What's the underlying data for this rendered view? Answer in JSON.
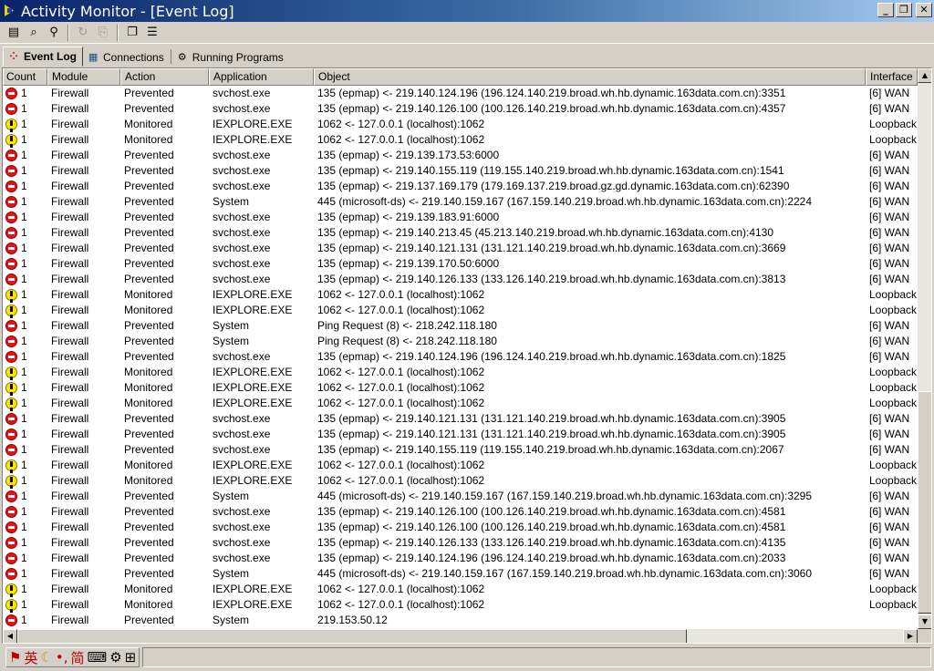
{
  "window": {
    "title": "Activity Monitor - [Event Log]",
    "minimize": "_",
    "restore": "❐",
    "close": "✕"
  },
  "toolbar": [
    {
      "name": "properties-icon",
      "glyph": "▤",
      "enabled": true
    },
    {
      "name": "find-icon",
      "glyph": "⌕",
      "enabled": true
    },
    {
      "name": "network-icon",
      "glyph": "⚲",
      "enabled": true
    },
    {
      "name": "refresh-icon",
      "glyph": "↻",
      "enabled": false
    },
    {
      "name": "export-icon",
      "glyph": "⎘",
      "enabled": false
    },
    {
      "name": "cascade-icon",
      "glyph": "❐",
      "enabled": true
    },
    {
      "name": "tile-icon",
      "glyph": "☰",
      "enabled": true
    }
  ],
  "tabs": [
    {
      "label": "Event Log",
      "icon": "⁘",
      "active": true
    },
    {
      "label": "Connections",
      "icon": "▦",
      "active": false
    },
    {
      "label": "Running Programs",
      "icon": "⚙",
      "active": false
    }
  ],
  "columns": {
    "count": "Count",
    "module": "Module",
    "action": "Action",
    "application": "Application",
    "object": "Object",
    "interface": "Interface"
  },
  "rows": [
    {
      "icon": "stop",
      "count": "1",
      "module": "Firewall",
      "action": "Prevented",
      "app": "svchost.exe",
      "object": "135 (epmap) <- 219.140.124.196 (196.124.140.219.broad.wh.hb.dynamic.163data.com.cn):3351",
      "iface": "[6] WAN"
    },
    {
      "icon": "stop",
      "count": "1",
      "module": "Firewall",
      "action": "Prevented",
      "app": "svchost.exe",
      "object": "135 (epmap) <- 219.140.126.100 (100.126.140.219.broad.wh.hb.dynamic.163data.com.cn):4357",
      "iface": "[6] WAN"
    },
    {
      "icon": "warn",
      "count": "1",
      "module": "Firewall",
      "action": "Monitored",
      "app": "IEXPLORE.EXE",
      "object": "1062 <- 127.0.0.1 (localhost):1062",
      "iface": "Loopback"
    },
    {
      "icon": "warn",
      "count": "1",
      "module": "Firewall",
      "action": "Monitored",
      "app": "IEXPLORE.EXE",
      "object": "1062 <- 127.0.0.1 (localhost):1062",
      "iface": "Loopback"
    },
    {
      "icon": "stop",
      "count": "1",
      "module": "Firewall",
      "action": "Prevented",
      "app": "svchost.exe",
      "object": "135 (epmap) <- 219.139.173.53:6000",
      "iface": "[6] WAN"
    },
    {
      "icon": "stop",
      "count": "1",
      "module": "Firewall",
      "action": "Prevented",
      "app": "svchost.exe",
      "object": "135 (epmap) <- 219.140.155.119 (119.155.140.219.broad.wh.hb.dynamic.163data.com.cn):1541",
      "iface": "[6] WAN"
    },
    {
      "icon": "stop",
      "count": "1",
      "module": "Firewall",
      "action": "Prevented",
      "app": "svchost.exe",
      "object": "135 (epmap) <- 219.137.169.179 (179.169.137.219.broad.gz.gd.dynamic.163data.com.cn):62390",
      "iface": "[6] WAN"
    },
    {
      "icon": "stop",
      "count": "1",
      "module": "Firewall",
      "action": "Prevented",
      "app": "System",
      "object": "445 (microsoft-ds) <- 219.140.159.167 (167.159.140.219.broad.wh.hb.dynamic.163data.com.cn):2224",
      "iface": "[6] WAN"
    },
    {
      "icon": "stop",
      "count": "1",
      "module": "Firewall",
      "action": "Prevented",
      "app": "svchost.exe",
      "object": "135 (epmap) <- 219.139.183.91:6000",
      "iface": "[6] WAN"
    },
    {
      "icon": "stop",
      "count": "1",
      "module": "Firewall",
      "action": "Prevented",
      "app": "svchost.exe",
      "object": "135 (epmap) <- 219.140.213.45 (45.213.140.219.broad.wh.hb.dynamic.163data.com.cn):4130",
      "iface": "[6] WAN"
    },
    {
      "icon": "stop",
      "count": "1",
      "module": "Firewall",
      "action": "Prevented",
      "app": "svchost.exe",
      "object": "135 (epmap) <- 219.140.121.131 (131.121.140.219.broad.wh.hb.dynamic.163data.com.cn):3669",
      "iface": "[6] WAN"
    },
    {
      "icon": "stop",
      "count": "1",
      "module": "Firewall",
      "action": "Prevented",
      "app": "svchost.exe",
      "object": "135 (epmap) <- 219.139.170.50:6000",
      "iface": "[6] WAN"
    },
    {
      "icon": "stop",
      "count": "1",
      "module": "Firewall",
      "action": "Prevented",
      "app": "svchost.exe",
      "object": "135 (epmap) <- 219.140.126.133 (133.126.140.219.broad.wh.hb.dynamic.163data.com.cn):3813",
      "iface": "[6] WAN"
    },
    {
      "icon": "warn",
      "count": "1",
      "module": "Firewall",
      "action": "Monitored",
      "app": "IEXPLORE.EXE",
      "object": "1062 <- 127.0.0.1 (localhost):1062",
      "iface": "Loopback"
    },
    {
      "icon": "warn",
      "count": "1",
      "module": "Firewall",
      "action": "Monitored",
      "app": "IEXPLORE.EXE",
      "object": "1062 <- 127.0.0.1 (localhost):1062",
      "iface": "Loopback"
    },
    {
      "icon": "stop",
      "count": "1",
      "module": "Firewall",
      "action": "Prevented",
      "app": "System",
      "object": "Ping Request (8) <- 218.242.118.180",
      "iface": "[6] WAN"
    },
    {
      "icon": "stop",
      "count": "1",
      "module": "Firewall",
      "action": "Prevented",
      "app": "System",
      "object": "Ping Request (8) <- 218.242.118.180",
      "iface": "[6] WAN"
    },
    {
      "icon": "stop",
      "count": "1",
      "module": "Firewall",
      "action": "Prevented",
      "app": "svchost.exe",
      "object": "135 (epmap) <- 219.140.124.196 (196.124.140.219.broad.wh.hb.dynamic.163data.com.cn):1825",
      "iface": "[6] WAN"
    },
    {
      "icon": "warn",
      "count": "1",
      "module": "Firewall",
      "action": "Monitored",
      "app": "IEXPLORE.EXE",
      "object": "1062 <- 127.0.0.1 (localhost):1062",
      "iface": "Loopback"
    },
    {
      "icon": "warn",
      "count": "1",
      "module": "Firewall",
      "action": "Monitored",
      "app": "IEXPLORE.EXE",
      "object": "1062 <- 127.0.0.1 (localhost):1062",
      "iface": "Loopback"
    },
    {
      "icon": "warn",
      "count": "1",
      "module": "Firewall",
      "action": "Monitored",
      "app": "IEXPLORE.EXE",
      "object": "1062 <- 127.0.0.1 (localhost):1062",
      "iface": "Loopback"
    },
    {
      "icon": "stop",
      "count": "1",
      "module": "Firewall",
      "action": "Prevented",
      "app": "svchost.exe",
      "object": "135 (epmap) <- 219.140.121.131 (131.121.140.219.broad.wh.hb.dynamic.163data.com.cn):3905",
      "iface": "[6] WAN"
    },
    {
      "icon": "stop",
      "count": "1",
      "module": "Firewall",
      "action": "Prevented",
      "app": "svchost.exe",
      "object": "135 (epmap) <- 219.140.121.131 (131.121.140.219.broad.wh.hb.dynamic.163data.com.cn):3905",
      "iface": "[6] WAN"
    },
    {
      "icon": "stop",
      "count": "1",
      "module": "Firewall",
      "action": "Prevented",
      "app": "svchost.exe",
      "object": "135 (epmap) <- 219.140.155.119 (119.155.140.219.broad.wh.hb.dynamic.163data.com.cn):2067",
      "iface": "[6] WAN"
    },
    {
      "icon": "warn",
      "count": "1",
      "module": "Firewall",
      "action": "Monitored",
      "app": "IEXPLORE.EXE",
      "object": "1062 <- 127.0.0.1 (localhost):1062",
      "iface": "Loopback"
    },
    {
      "icon": "warn",
      "count": "1",
      "module": "Firewall",
      "action": "Monitored",
      "app": "IEXPLORE.EXE",
      "object": "1062 <- 127.0.0.1 (localhost):1062",
      "iface": "Loopback"
    },
    {
      "icon": "stop",
      "count": "1",
      "module": "Firewall",
      "action": "Prevented",
      "app": "System",
      "object": "445 (microsoft-ds) <- 219.140.159.167 (167.159.140.219.broad.wh.hb.dynamic.163data.com.cn):3295",
      "iface": "[6] WAN"
    },
    {
      "icon": "stop",
      "count": "1",
      "module": "Firewall",
      "action": "Prevented",
      "app": "svchost.exe",
      "object": "135 (epmap) <- 219.140.126.100 (100.126.140.219.broad.wh.hb.dynamic.163data.com.cn):4581",
      "iface": "[6] WAN"
    },
    {
      "icon": "stop",
      "count": "1",
      "module": "Firewall",
      "action": "Prevented",
      "app": "svchost.exe",
      "object": "135 (epmap) <- 219.140.126.100 (100.126.140.219.broad.wh.hb.dynamic.163data.com.cn):4581",
      "iface": "[6] WAN"
    },
    {
      "icon": "stop",
      "count": "1",
      "module": "Firewall",
      "action": "Prevented",
      "app": "svchost.exe",
      "object": "135 (epmap) <- 219.140.126.133 (133.126.140.219.broad.wh.hb.dynamic.163data.com.cn):4135",
      "iface": "[6] WAN"
    },
    {
      "icon": "stop",
      "count": "1",
      "module": "Firewall",
      "action": "Prevented",
      "app": "svchost.exe",
      "object": "135 (epmap) <- 219.140.124.196 (196.124.140.219.broad.wh.hb.dynamic.163data.com.cn):2033",
      "iface": "[6] WAN"
    },
    {
      "icon": "stop",
      "count": "1",
      "module": "Firewall",
      "action": "Prevented",
      "app": "System",
      "object": "445 (microsoft-ds) <- 219.140.159.167 (167.159.140.219.broad.wh.hb.dynamic.163data.com.cn):3060",
      "iface": "[6] WAN"
    },
    {
      "icon": "warn",
      "count": "1",
      "module": "Firewall",
      "action": "Monitored",
      "app": "IEXPLORE.EXE",
      "object": "1062 <- 127.0.0.1 (localhost):1062",
      "iface": "Loopback"
    },
    {
      "icon": "warn",
      "count": "1",
      "module": "Firewall",
      "action": "Monitored",
      "app": "IEXPLORE.EXE",
      "object": "1062 <- 127.0.0.1 (localhost):1062",
      "iface": "Loopback"
    },
    {
      "icon": "stop",
      "count": "1",
      "module": "Firewall",
      "action": "Prevented",
      "app": "System",
      "object": "219.153.50.12",
      "iface": ""
    }
  ],
  "scroll": {
    "up": "▲",
    "down": "▼",
    "left": "◀",
    "right": "▶"
  },
  "ime": {
    "logo": "⚑",
    "lang": "英",
    "moon": "☾",
    "punct": "•,",
    "mode": "简",
    "keyboard": "⌨",
    "tools": "⚙",
    "help": "⊞"
  },
  "colors": {
    "titlebar_start": "#0a246a",
    "titlebar_end": "#a6caf0",
    "prevented": "#e8101a",
    "monitored": "#ffe400"
  }
}
